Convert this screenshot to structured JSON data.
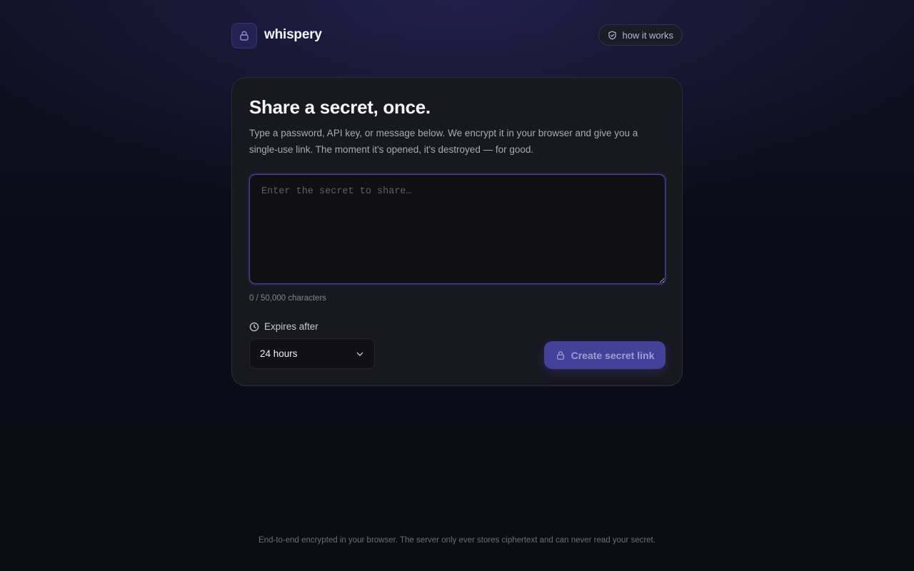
{
  "brand": {
    "name": "whispery",
    "logo_icon": "lock-icon"
  },
  "header": {
    "how_it_works_label": "how it works",
    "how_it_works_icon": "shield-icon"
  },
  "card": {
    "title": "Share a secret, once.",
    "description": "Type a password, API key, or message below. We encrypt it in your browser and give you a single-use link. The moment it's opened, it's destroyed — for good.",
    "secret_input": {
      "value": "",
      "placeholder": "Enter the secret to share…"
    },
    "char_count": "0 / 50,000 characters",
    "expires": {
      "label": "Expires after",
      "icon": "clock-icon",
      "selected": "24 hours"
    },
    "create_button": {
      "label": "Create secret link",
      "icon": "lock-icon"
    }
  },
  "footer": {
    "note": "End-to-end encrypted in your browser. The server only ever stores ciphertext and can never read your secret."
  },
  "colors": {
    "accent": "#44419a",
    "accent_text": "#9e9cd4",
    "background": "#0c0c14",
    "card": "#18181f"
  }
}
